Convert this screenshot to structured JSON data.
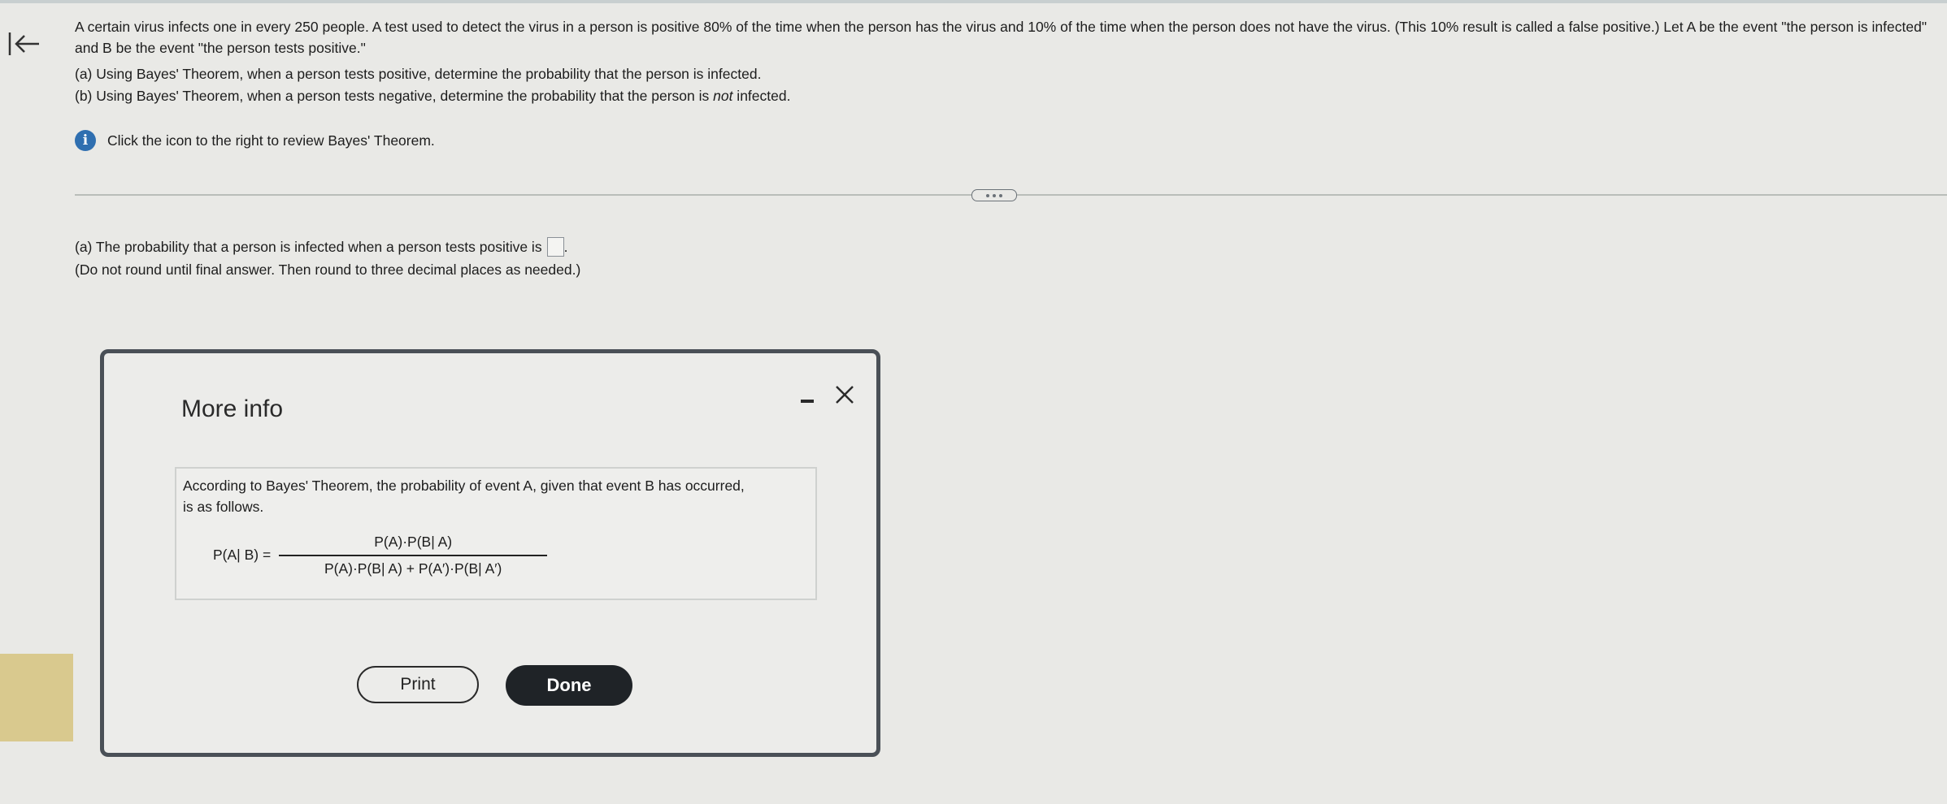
{
  "question": {
    "intro": "A certain virus infects one in every 250 people. A test used to detect the virus in a person is positive 80% of the time when the person has the virus and 10% of the time when the person does not have the virus. (This 10% result is called a false positive.) Let A be the event \"the person is infected\" and B be the event \"the person tests positive.\"",
    "part_a": "(a) Using Bayes' Theorem, when a person tests positive, determine the probability that the person is infected.",
    "part_b_before": "(b) Using Bayes' Theorem, when a person tests negative, determine the probability that the person is ",
    "part_b_emph": "not",
    "part_b_after": " infected.",
    "info_text": "Click the icon to the right to review Bayes' Theorem."
  },
  "answer": {
    "prompt_before": "(a) The probability that a person is infected when a person tests positive is",
    "prompt_after": ".",
    "note": "(Do not round until final answer. Then round to three decimal places as needed.)",
    "input_value": ""
  },
  "dialog": {
    "title": "More info",
    "text": "According to Bayes' Theorem, the probability of event A, given that event B has occurred, is as follows.",
    "formula_lhs": "P(A| B) =",
    "formula_numerator": "P(A)·P(B| A)",
    "formula_denominator": "P(A)·P(B| A) + P(A′)·P(B| A′)",
    "print_label": "Print",
    "done_label": "Done"
  },
  "icons": {
    "back": "back-arrow-icon",
    "info": "info-icon",
    "minimize": "minimize-icon",
    "close": "close-icon",
    "more": "more-dots-icon"
  },
  "colors": {
    "background": "#e9e9e6",
    "info_icon": "#2f6fb0",
    "done_button": "#1f2327",
    "dialog_border": "#4a5057"
  }
}
